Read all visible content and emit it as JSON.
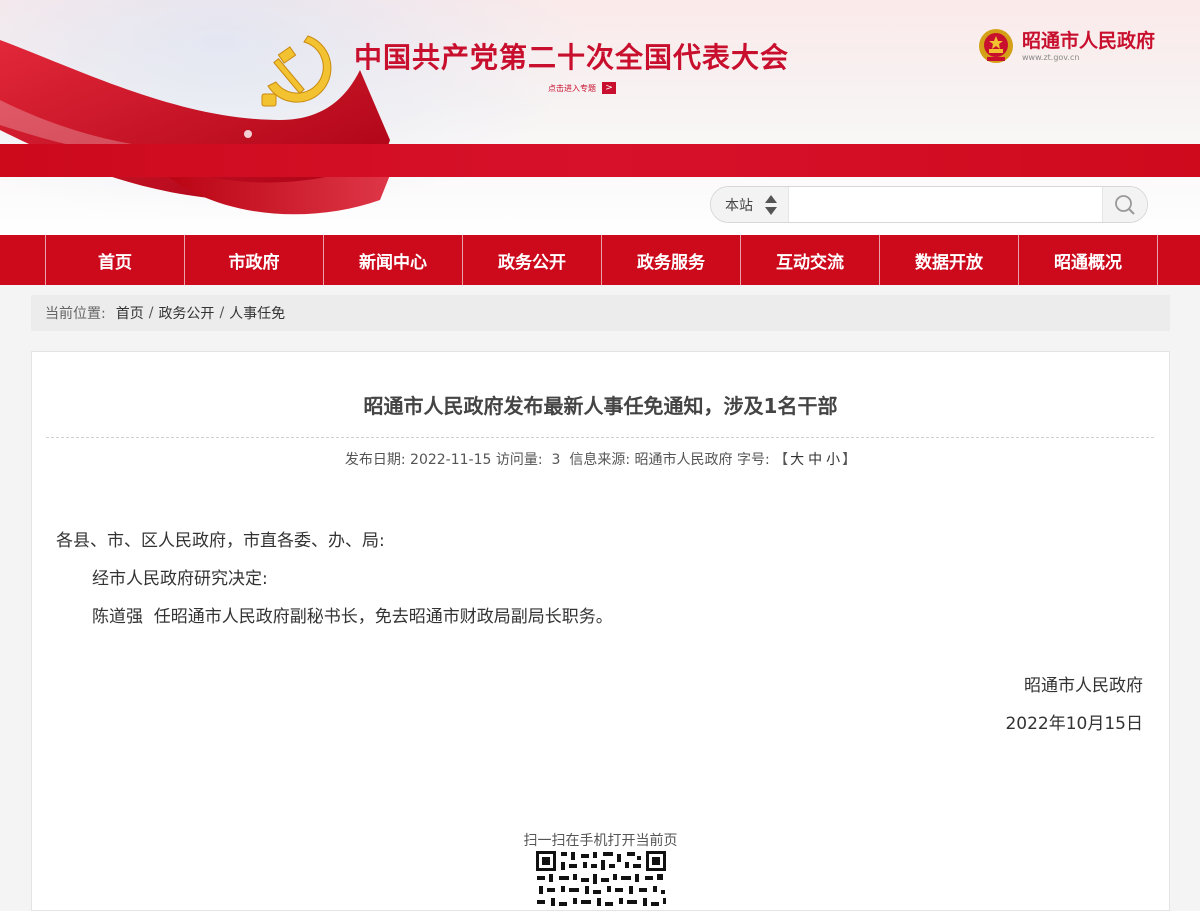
{
  "header": {
    "congress_title": "中国共产党第二十次全国代表大会",
    "enter_topic": "点击进入专题",
    "enter_arrow": ">",
    "gov_name": "昭通市人民政府",
    "gov_url": "www.zt.gov.cn"
  },
  "search": {
    "scope": "本站",
    "value": "",
    "placeholder": ""
  },
  "nav": {
    "items": [
      "首页",
      "市政府",
      "新闻中心",
      "政务公开",
      "政务服务",
      "互动交流",
      "数据开放",
      "昭通概况"
    ]
  },
  "breadcrumb": {
    "label": "当前位置:",
    "items": [
      "首页",
      "政务公开",
      "人事任免"
    ],
    "separator": "/"
  },
  "article": {
    "title": "昭通市人民政府发布最新人事任免通知，涉及1名干部",
    "meta": {
      "date_label": "发布日期:",
      "date": "2022-11-15",
      "visits_label": "访问量:",
      "visits": "3",
      "source_label": "信息来源:",
      "source": "昭通市人民政府",
      "fontsize_label": "字号:",
      "fontsize_open": "【",
      "fontsize_large": "大",
      "fontsize_medium": "中",
      "fontsize_small": "小",
      "fontsize_close": "】"
    },
    "paragraphs": [
      "各县、市、区人民政府，市直各委、办、局:",
      "经市人民政府研究决定:",
      "陈道强  任昭通市人民政府副秘书长，免去昭通市财政局副局长职务。"
    ],
    "signature": "昭通市人民政府",
    "sign_date": "2022年10月15日"
  },
  "qr": {
    "caption": "扫一扫在手机打开当前页"
  },
  "colors": {
    "brand_red": "#cc0a1c",
    "gold": "#f2c230"
  }
}
